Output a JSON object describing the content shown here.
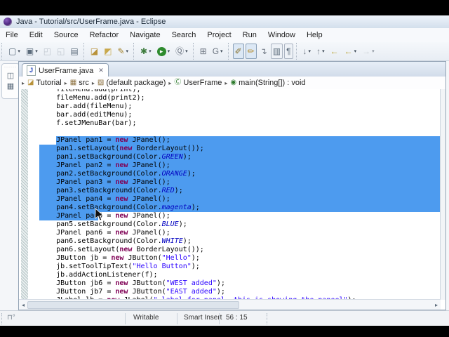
{
  "window": {
    "title": "Java - Tutorial/src/UserFrame.java - Eclipse"
  },
  "menu_bar": {
    "items": [
      "File",
      "Edit",
      "Source",
      "Refactor",
      "Navigate",
      "Search",
      "Project",
      "Run",
      "Window",
      "Help"
    ]
  },
  "toolbar": {
    "groups": [
      {
        "icons": [
          {
            "name": "new-wizard-icon",
            "glyph": "▢",
            "color": "#5b6b7b",
            "dropdown": true
          },
          {
            "name": "new-java-element-icon",
            "glyph": "▣",
            "color": "#5b6b7b",
            "dropdown": true
          },
          {
            "name": "save-icon",
            "glyph": "◰",
            "color": "#9aa4ae",
            "disabled": true
          },
          {
            "name": "save-all-icon",
            "glyph": "◱",
            "color": "#9aa4ae",
            "disabled": true
          },
          {
            "name": "print-icon",
            "glyph": "▤",
            "color": "#5b6b7b"
          }
        ]
      },
      {
        "icons": [
          {
            "name": "folder-open-icon",
            "glyph": "◪",
            "color": "#b8923a"
          },
          {
            "name": "folder-icon",
            "glyph": "◩",
            "color": "#c9a94e"
          },
          {
            "name": "external-tools-icon",
            "glyph": "✎",
            "color": "#a5842f",
            "dropdown": true
          }
        ]
      },
      {
        "icons": [
          {
            "name": "debug-icon",
            "glyph": "✱",
            "color": "#3f7d3f",
            "dropdown": true
          },
          {
            "name": "run-icon",
            "glyph": "▸",
            "color": "#ffffff",
            "circle": "#2e8b2e",
            "dropdown": true
          },
          {
            "name": "run-external-icon",
            "glyph": "Ⓠ",
            "color": "#6b7480",
            "dropdown": true
          }
        ]
      },
      {
        "icons": [
          {
            "name": "new-java-project-icon",
            "glyph": "⊞",
            "color": "#6b7480"
          },
          {
            "name": "java-search-icon",
            "glyph": "G",
            "color": "#6b7480",
            "dropdown": true
          }
        ]
      },
      {
        "icons": [
          {
            "name": "mark-occurrences-toggle",
            "glyph": "✐",
            "color": "#8a7430",
            "pressed": true
          },
          {
            "name": "breadcrumb-toggle",
            "glyph": "✏",
            "color": "#b8923a",
            "pressed": true
          },
          {
            "name": "link-with-editor-icon",
            "glyph": "↴",
            "color": "#6b7480"
          },
          {
            "name": "block-selection-toggle",
            "glyph": "▥",
            "color": "#5b6b7b",
            "framed": true
          },
          {
            "name": "show-whitespace-toggle",
            "glyph": "¶",
            "color": "#5b6b7b",
            "framed": true
          }
        ]
      },
      {
        "icons": [
          {
            "name": "next-annotation-icon",
            "glyph": "↓",
            "color": "#6b7480",
            "dropdown": true
          },
          {
            "name": "previous-annotation-icon",
            "glyph": "↑",
            "color": "#6b7480",
            "dropdown": true
          },
          {
            "name": "last-edit-location-icon",
            "glyph": "←",
            "color": "#b8a22e"
          },
          {
            "name": "back-icon",
            "glyph": "←",
            "color": "#b8a22e",
            "dropdown": true
          },
          {
            "name": "forward-icon",
            "glyph": "→",
            "color": "#b2b8be",
            "dropdown": true,
            "disabled": true
          }
        ]
      }
    ]
  },
  "fast_view": {
    "icons": [
      {
        "name": "restore-view-icon",
        "glyph": "◫",
        "color": "#5b6b7b"
      },
      {
        "name": "package-explorer-view-icon",
        "glyph": "▦",
        "color": "#5b6b7b"
      }
    ]
  },
  "editor_tab": {
    "label": "UserFrame.java",
    "close_glyph": "✕",
    "file_icon_letter": "J"
  },
  "breadcrumb": {
    "arrow": "▸",
    "items": [
      {
        "name": "tutorial",
        "label": "Tutorial",
        "glyph": "◪",
        "color": "#b8923a"
      },
      {
        "name": "src",
        "label": "src",
        "glyph": "▦",
        "color": "#8a6d3b"
      },
      {
        "name": "default-package",
        "label": "(default package)",
        "glyph": "▨",
        "color": "#8a6d3b"
      },
      {
        "name": "userframe",
        "label": "UserFrame",
        "glyph": "Ⓒ",
        "color": "#2c7a2c"
      },
      {
        "name": "main-method",
        "label": "main(String[]) : void",
        "glyph": "◉",
        "color": "#2c7a2c"
      }
    ]
  },
  "code": {
    "lines": [
      {
        "sel": "none",
        "segs": [
          [
            "p",
            "    fileMenu.add(print);"
          ]
        ]
      },
      {
        "sel": "none",
        "segs": [
          [
            "p",
            "    fileMenu.add(print2);"
          ]
        ]
      },
      {
        "sel": "none",
        "segs": [
          [
            "p",
            "    bar.add(fileMenu);"
          ]
        ]
      },
      {
        "sel": "none",
        "segs": [
          [
            "p",
            "    bar.add(editMenu);"
          ]
        ]
      },
      {
        "sel": "none",
        "segs": [
          [
            "p",
            "    f.setJMenuBar(bar);"
          ]
        ]
      },
      {
        "sel": "none",
        "segs": [
          [
            "p",
            ""
          ]
        ]
      },
      {
        "sel": "text",
        "segs": [
          [
            "p",
            "    JPanel pan1 = "
          ],
          [
            "k",
            "new"
          ],
          [
            "p",
            " JPanel();"
          ]
        ]
      },
      {
        "sel": "full",
        "segs": [
          [
            "p",
            "    pan1.setLayout("
          ],
          [
            "k",
            "new"
          ],
          [
            "p",
            " BorderLayout());"
          ]
        ]
      },
      {
        "sel": "full",
        "segs": [
          [
            "p",
            "    pan1.setBackground(Color."
          ],
          [
            "f",
            "GREEN"
          ],
          [
            "p",
            ");"
          ]
        ]
      },
      {
        "sel": "full",
        "segs": [
          [
            "p",
            "    JPanel pan2 = "
          ],
          [
            "k",
            "new"
          ],
          [
            "p",
            " JPanel();"
          ]
        ]
      },
      {
        "sel": "full",
        "segs": [
          [
            "p",
            "    pan2.setBackground(Color."
          ],
          [
            "f",
            "ORANGE"
          ],
          [
            "p",
            ");"
          ]
        ]
      },
      {
        "sel": "full",
        "segs": [
          [
            "p",
            "    JPanel pan3 = "
          ],
          [
            "k",
            "new"
          ],
          [
            "p",
            " JPanel();"
          ]
        ]
      },
      {
        "sel": "full",
        "segs": [
          [
            "p",
            "    pan3.setBackground(Color."
          ],
          [
            "f",
            "RED"
          ],
          [
            "p",
            ");"
          ]
        ]
      },
      {
        "sel": "full",
        "segs": [
          [
            "p",
            "    JPanel pan4 = "
          ],
          [
            "k",
            "new"
          ],
          [
            "p",
            " JPanel();"
          ]
        ]
      },
      {
        "sel": "full",
        "segs": [
          [
            "p",
            "    pan4.setBackground(Color."
          ],
          [
            "f",
            "magenta"
          ],
          [
            "p",
            ");"
          ]
        ]
      },
      {
        "sel": "prefix",
        "prefix_chars": 14,
        "segs": [
          [
            "p",
            "    JPanel pan5 = "
          ],
          [
            "k",
            "new"
          ],
          [
            "p",
            " JPanel();"
          ]
        ]
      },
      {
        "sel": "none",
        "segs": [
          [
            "p",
            "    pan5.setBackground(Color."
          ],
          [
            "f",
            "BLUE"
          ],
          [
            "p",
            ");"
          ]
        ]
      },
      {
        "sel": "none",
        "segs": [
          [
            "p",
            "    JPanel pan6 = "
          ],
          [
            "k",
            "new"
          ],
          [
            "p",
            " JPanel();"
          ]
        ]
      },
      {
        "sel": "none",
        "segs": [
          [
            "p",
            "    pan6.setBackground(Color."
          ],
          [
            "f",
            "WHITE"
          ],
          [
            "p",
            ");"
          ]
        ]
      },
      {
        "sel": "none",
        "segs": [
          [
            "p",
            "    pan6.setLayout("
          ],
          [
            "k",
            "new"
          ],
          [
            "p",
            " BorderLayout());"
          ]
        ]
      },
      {
        "sel": "none",
        "segs": [
          [
            "p",
            "    JButton jb = "
          ],
          [
            "k",
            "new"
          ],
          [
            "p",
            " JButton("
          ],
          [
            "s",
            "\"Hello\""
          ],
          [
            "p",
            ");"
          ]
        ]
      },
      {
        "sel": "none",
        "segs": [
          [
            "p",
            "    jb.setToolTipText("
          ],
          [
            "s",
            "\"Hello Button\""
          ],
          [
            "p",
            ");"
          ]
        ]
      },
      {
        "sel": "none",
        "segs": [
          [
            "p",
            "    jb.addActionListener(f);"
          ]
        ]
      },
      {
        "sel": "none",
        "segs": [
          [
            "p",
            "    JButton jb6 = "
          ],
          [
            "k",
            "new"
          ],
          [
            "p",
            " JButton("
          ],
          [
            "s",
            "\"WEST added\""
          ],
          [
            "p",
            ");"
          ]
        ]
      },
      {
        "sel": "none",
        "segs": [
          [
            "p",
            "    JButton jb7 = "
          ],
          [
            "k",
            "new"
          ],
          [
            "p",
            " JButton("
          ],
          [
            "s",
            "\"EAST added\""
          ],
          [
            "p",
            ");"
          ]
        ]
      },
      {
        "sel": "none",
        "segs": [
          [
            "p",
            "    JLabel lb = "
          ],
          [
            "k",
            "new"
          ],
          [
            "p",
            " JLabel("
          ],
          [
            "s",
            "\" label for panel, this is showing the paneel\""
          ],
          [
            "p",
            ");"
          ]
        ]
      }
    ]
  },
  "scrollbars": {
    "h_left_arrow": "◂",
    "h_right_arrow": "▸"
  },
  "status_bar": {
    "mode_icon_glyph": "⊓°",
    "writable": "Writable",
    "input_mode": "Smart Insert",
    "caret_position": "56 : 15"
  },
  "colors": {
    "selection": "#4d9bef",
    "keyword": "#7f0055",
    "string": "#2a00ff",
    "static_field": "#0000c0",
    "code_text": "#000000"
  }
}
